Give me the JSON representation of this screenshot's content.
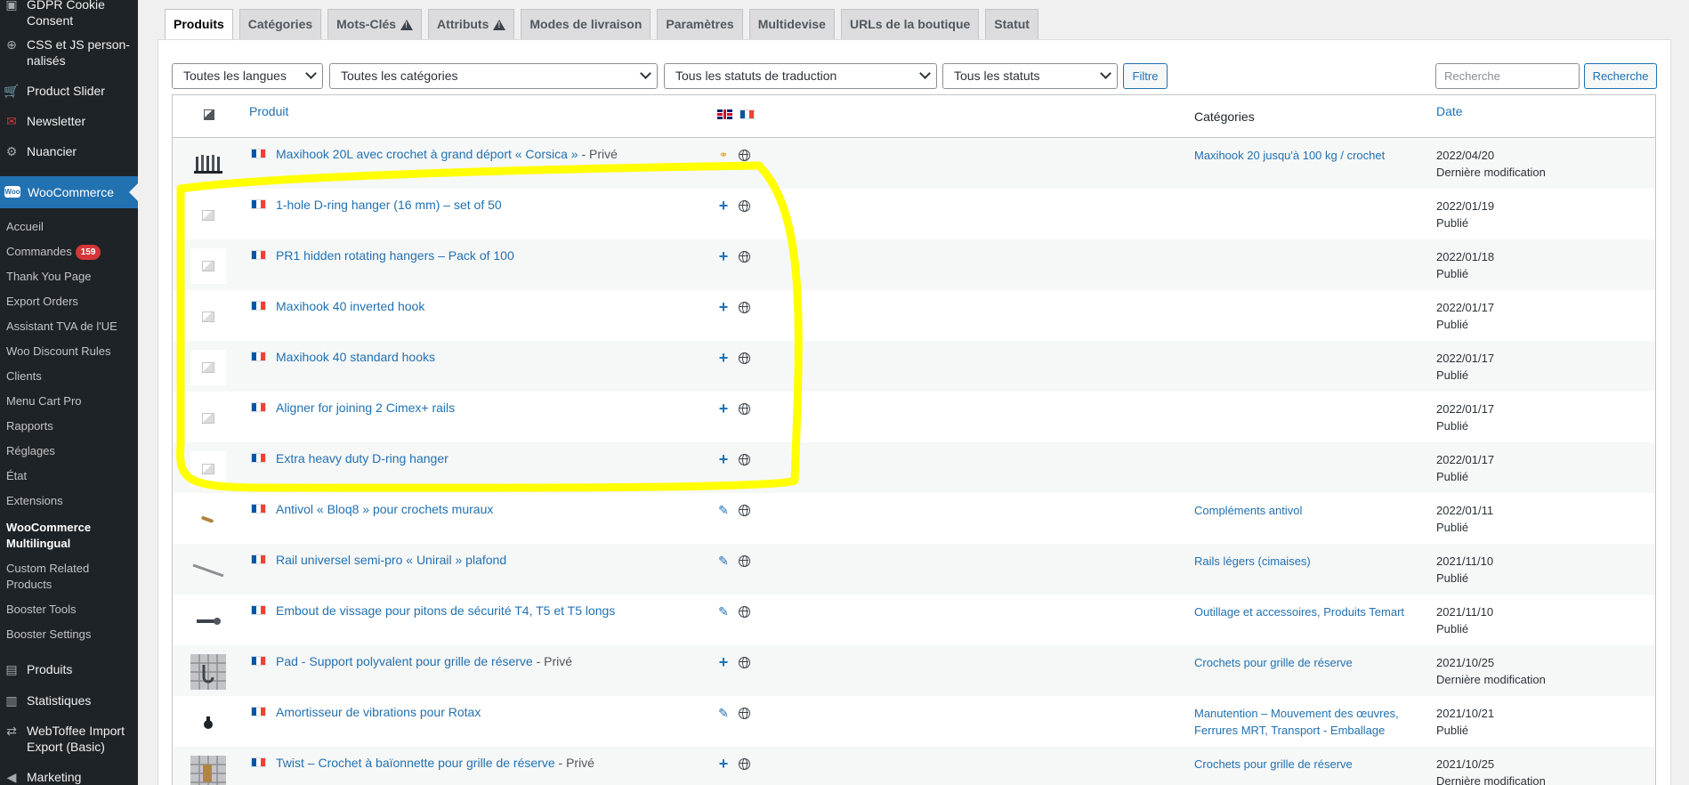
{
  "sidebar": {
    "items_top": [
      {
        "label": "GDPR Cookie Consent",
        "icon": "shield-icon"
      },
      {
        "label": "CSS et JS person-nalisés",
        "icon": "plus-circle-icon"
      },
      {
        "label": "Product Slider",
        "icon": "cart-icon"
      },
      {
        "label": "Newsletter",
        "icon": "mail-icon"
      },
      {
        "label": "Nuancier",
        "icon": "gear-icon"
      }
    ],
    "woocommerce_label": "WooCommerce",
    "submenu": [
      {
        "label": "Accueil"
      },
      {
        "label": "Commandes",
        "badge": "159"
      },
      {
        "label": "Thank You Page"
      },
      {
        "label": "Export Orders"
      },
      {
        "label": "Assistant TVA de l'UE"
      },
      {
        "label": "Woo Discount Rules"
      },
      {
        "label": "Clients"
      },
      {
        "label": "Menu Cart Pro"
      },
      {
        "label": "Rapports"
      },
      {
        "label": "Réglages"
      },
      {
        "label": "État"
      },
      {
        "label": "Extensions"
      },
      {
        "label": "WooCommerce Multilingual",
        "current": true
      },
      {
        "label": "Custom Related Products"
      },
      {
        "label": "Booster Tools"
      },
      {
        "label": "Booster Settings"
      }
    ],
    "items_bottom": [
      {
        "label": "Produits",
        "icon": "archive-icon"
      },
      {
        "label": "Statistiques",
        "icon": "bar-chart-icon"
      },
      {
        "label": "WebToffee Import Export (Basic)",
        "icon": "import-export-icon"
      },
      {
        "label": "Marketing",
        "icon": "megaphone-icon"
      }
    ]
  },
  "tabs": [
    {
      "label": "Produits",
      "active": true
    },
    {
      "label": "Catégories"
    },
    {
      "label": "Mots-Clés",
      "warning": true
    },
    {
      "label": "Attributs",
      "warning": true
    },
    {
      "label": "Modes de livraison"
    },
    {
      "label": "Paramètres"
    },
    {
      "label": "Multidevise"
    },
    {
      "label": "URLs de la boutique"
    },
    {
      "label": "Statut"
    }
  ],
  "filters": {
    "language": "Toutes les langues",
    "category": "Toutes les catégories",
    "translation_status": "Tous les statuts de traduction",
    "status": "Tous les statuts",
    "filter_button": "Filtre",
    "search_placeholder": "Recherche",
    "search_button": "Recherche"
  },
  "table": {
    "headers": {
      "product": "Produit",
      "categories": "Catégories",
      "date": "Date"
    },
    "rows": [
      {
        "name": "Maxihook 20L avec crochet à grand déport « Corsica »",
        "suffix": " - Privé",
        "action": "duplicate",
        "category": "Maxihook 20 jusqu'à 100 kg / crochet",
        "date": "2022/04/20",
        "status": "Dernière modification",
        "thumb": "hooks"
      },
      {
        "name": "1-hole D-ring hanger (16 mm) – set of 50",
        "suffix": "",
        "action": "add",
        "category": "",
        "date": "2022/01/19",
        "status": "Publié",
        "thumb": "placeholder"
      },
      {
        "name": "PR1 hidden rotating hangers – Pack of 100",
        "suffix": "",
        "action": "add",
        "category": "",
        "date": "2022/01/18",
        "status": "Publié",
        "thumb": "placeholder"
      },
      {
        "name": "Maxihook 40 inverted hook",
        "suffix": "",
        "action": "add",
        "category": "",
        "date": "2022/01/17",
        "status": "Publié",
        "thumb": "placeholder"
      },
      {
        "name": "Maxihook 40 standard hooks",
        "suffix": "",
        "action": "add",
        "category": "",
        "date": "2022/01/17",
        "status": "Publié",
        "thumb": "placeholder"
      },
      {
        "name": "Aligner for joining 2 Cimex+ rails",
        "suffix": "",
        "action": "add",
        "category": "",
        "date": "2022/01/17",
        "status": "Publié",
        "thumb": "placeholder"
      },
      {
        "name": "Extra heavy duty D-ring hanger",
        "suffix": "",
        "action": "add",
        "category": "",
        "date": "2022/01/17",
        "status": "Publié",
        "thumb": "placeholder"
      },
      {
        "name": "Antivol « Bloq8 » pour crochets muraux",
        "suffix": "",
        "action": "edit",
        "category": "Compléments antivol",
        "date": "2022/01/11",
        "status": "Publié",
        "thumb": "screw"
      },
      {
        "name": "Rail universel semi-pro « Unirail » plafond",
        "suffix": "",
        "action": "edit",
        "category": "Rails légers (cimaises)",
        "date": "2021/11/10",
        "status": "Publié",
        "thumb": "rail"
      },
      {
        "name": "Embout de vissage pour pitons de sécurité T4, T5 et T5 longs",
        "suffix": "",
        "action": "edit",
        "category": "Outillage et accessoires, Produits Temart",
        "date": "2021/11/10",
        "status": "Publié",
        "thumb": "bit"
      },
      {
        "name": "Pad - Support polyvalent pour grille de réserve",
        "suffix": " - Privé",
        "action": "add",
        "category": "Crochets pour grille de réserve",
        "date": "2021/10/25",
        "status": "Dernière modification",
        "thumb": "grid"
      },
      {
        "name": "Amortisseur de vibrations pour Rotax",
        "suffix": "",
        "action": "edit",
        "category": "Manutention – Mouvement des œuvres, Ferrures MRT, Transport - Emballage",
        "date": "2021/10/21",
        "status": "Publié",
        "thumb": "damper"
      },
      {
        "name": "Twist – Crochet à baïonnette pour grille de réserve",
        "suffix": " - Privé",
        "action": "add",
        "category": "Crochets pour grille de réserve",
        "date": "2021/10/25",
        "status": "Dernière modification",
        "thumb": "grid2"
      }
    ]
  },
  "colors": {
    "highlight": "#ffff00",
    "link": "#2271b1",
    "sidebar": "#1d2327",
    "active": "#2271b1"
  }
}
